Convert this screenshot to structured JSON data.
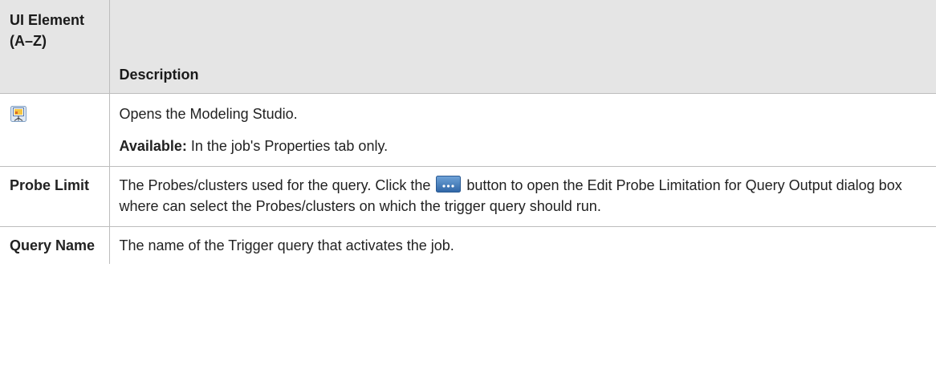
{
  "table": {
    "headers": {
      "element": "UI Element (A–Z)",
      "description": "Description"
    },
    "rows": [
      {
        "element_icon": "modeling-studio-icon",
        "description": "Opens the Modeling Studio.",
        "note_label": "Available:",
        "note_text": " In the job's Properties tab only."
      },
      {
        "element": "Probe Limit",
        "desc_before": "The Probes/clusters used for the query. Click the ",
        "button_icon": "ellipsis-button-icon",
        "desc_after": " button to open the Edit Probe Limitation for Query Output dialog box where can select the Probes/clusters on which the trigger query should run."
      },
      {
        "element": "Query Name",
        "description": "The name of the Trigger query that activates the job."
      }
    ]
  },
  "colors": {
    "header_bg": "#e5e5e5",
    "border": "#bdbdbd",
    "button_blue": "#3a78b8"
  }
}
